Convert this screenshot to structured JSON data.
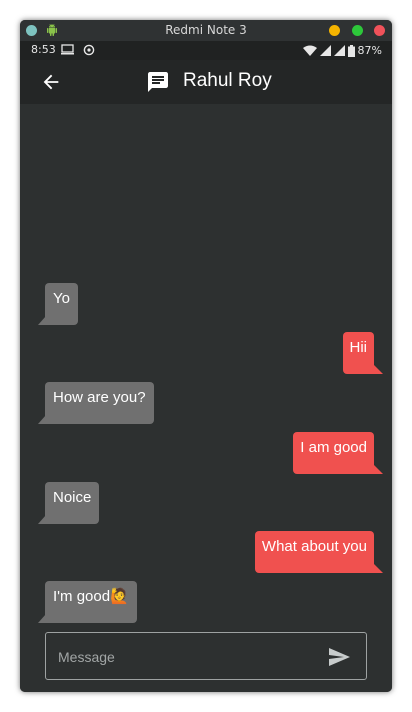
{
  "window": {
    "title": "Redmi Note 3",
    "controls": {
      "left_dot_color": "#7ec3c0",
      "minimize_color": "#f5b400",
      "maximize_color": "#2dc83a",
      "close_color": "#f0525a"
    }
  },
  "status_bar": {
    "time": "8:53",
    "battery": "87%",
    "icons": [
      "screen-cast-icon",
      "sync-icon",
      "wifi-icon",
      "signal-icon",
      "signal-icon",
      "battery-icon"
    ]
  },
  "app_bar": {
    "title": "Rahul Roy",
    "back_icon": "arrow-left-icon",
    "chat_icon": "message-icon"
  },
  "messages": [
    {
      "text": "Yo",
      "from": "them"
    },
    {
      "text": "Hii",
      "from": "me"
    },
    {
      "text": "How are you?",
      "from": "them"
    },
    {
      "text": "I am good",
      "from": "me"
    },
    {
      "text": "Noice",
      "from": "them"
    },
    {
      "text": "What about you",
      "from": "me"
    },
    {
      "text": "I'm good🙋",
      "from": "them"
    }
  ],
  "composer": {
    "placeholder": "Message",
    "value": "",
    "send_icon": "send-icon"
  },
  "colors": {
    "sent_bubble": "#f0514f",
    "received_bubble": "#707070",
    "background": "#2d3030",
    "app_bar": "#242626"
  }
}
